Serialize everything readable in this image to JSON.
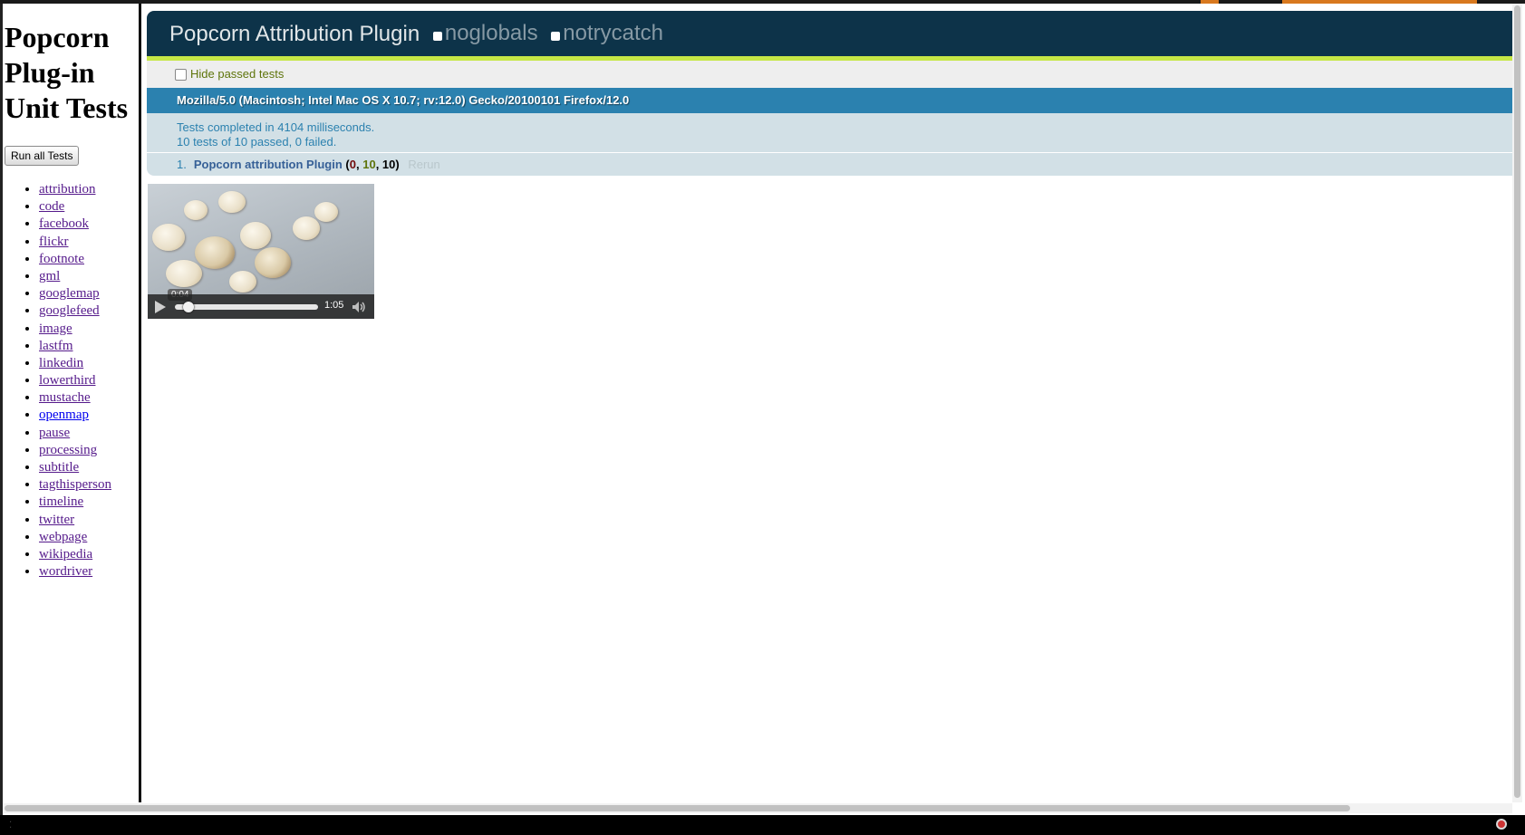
{
  "sidebar": {
    "title": "Popcorn Plug-in Unit Tests",
    "run_all_label": "Run all Tests",
    "tests": [
      {
        "label": "attribution"
      },
      {
        "label": "code"
      },
      {
        "label": "facebook"
      },
      {
        "label": "flickr"
      },
      {
        "label": "footnote"
      },
      {
        "label": "gml"
      },
      {
        "label": "googlemap"
      },
      {
        "label": "googlefeed"
      },
      {
        "label": "image"
      },
      {
        "label": "lastfm"
      },
      {
        "label": "linkedin"
      },
      {
        "label": "lowerthird"
      },
      {
        "label": "mustache"
      },
      {
        "label": "openmap"
      },
      {
        "label": "pause"
      },
      {
        "label": "processing"
      },
      {
        "label": "subtitle"
      },
      {
        "label": "tagthisperson"
      },
      {
        "label": "timeline"
      },
      {
        "label": "twitter"
      },
      {
        "label": "webpage"
      },
      {
        "label": "wikipedia"
      },
      {
        "label": "wordriver"
      }
    ]
  },
  "header": {
    "title": "Popcorn Attribution Plugin",
    "options": [
      "noglobals",
      "notrycatch"
    ]
  },
  "toolbar": {
    "hide_passed_label": "Hide passed tests"
  },
  "user_agent": "Mozilla/5.0 (Macintosh; Intel Mac OS X 10.7; rv:12.0) Gecko/20100101 Firefox/12.0",
  "result": {
    "line1": "Tests completed in 4104 milliseconds.",
    "line2": "10 tests of 10 passed, 0 failed."
  },
  "tests": [
    {
      "number": "1.",
      "name": "Popcorn attribution Plugin",
      "failed": "0",
      "passed": "10",
      "total": "10",
      "rerun_label": "Rerun"
    }
  ],
  "video": {
    "current_time": "0:04",
    "duration": "1:05",
    "progress": 0.06
  },
  "colors": {
    "header_bg": "#0d3349",
    "banner": "#c6e746",
    "useragent_bg": "#2b81af",
    "result_bg": "#d2e0e6"
  }
}
